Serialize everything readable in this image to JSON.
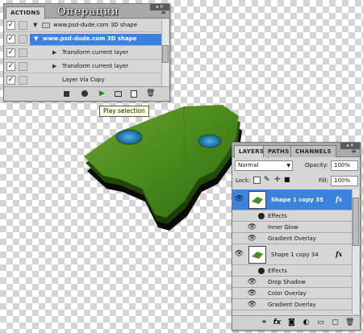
{
  "actions_panel": {
    "tab_label": "ACTIONS",
    "overlay_title": "Операции",
    "rows": [
      {
        "label": "www.psd-dude.com 3D shape",
        "checked": true,
        "type": "set"
      },
      {
        "label": "www.psd-dude.com 3D shape",
        "checked": true,
        "type": "action",
        "selected": true
      },
      {
        "label": "Transform current layer",
        "checked": true,
        "type": "step"
      },
      {
        "label": "Transform current layer",
        "checked": true,
        "type": "step"
      },
      {
        "label": "Layer Via Copy",
        "checked": true,
        "type": "step"
      }
    ],
    "toolbar_icons": [
      "stop-icon",
      "record-icon",
      "play-icon",
      "new-set-icon",
      "new-action-icon",
      "delete-icon"
    ]
  },
  "tooltip": {
    "text": "Play selection"
  },
  "layers_panel": {
    "tabs": [
      "LAYERS",
      "PATHS",
      "CHANNELS"
    ],
    "blend_mode": "Normal",
    "opacity_label": "Opacity:",
    "opacity_value": "100%",
    "lock_label": "Lock:",
    "fill_label": "Fill:",
    "fill_value": "100%",
    "fx_label": "fx",
    "layers": [
      {
        "name": "Shape 1 copy 35",
        "selected": true,
        "effects_label": "Effects",
        "effects": [
          "Inner Glow",
          "Gradient Overlay"
        ]
      },
      {
        "name": "Shape 1 copy 34",
        "selected": false,
        "effects_label": "Effects",
        "effects": [
          "Drop Shadow",
          "Color Overlay",
          "Gradient Overlay"
        ]
      }
    ],
    "toolbar_icons": [
      "link-icon",
      "fx-icon",
      "mask-icon",
      "adjustment-icon",
      "group-icon",
      "new-layer-icon",
      "trash-icon"
    ]
  },
  "colors": {
    "selection": "#3a82dd",
    "grass": "#4f8a1f",
    "water": "#1f7fc0",
    "panel": "#d6d6d6"
  }
}
